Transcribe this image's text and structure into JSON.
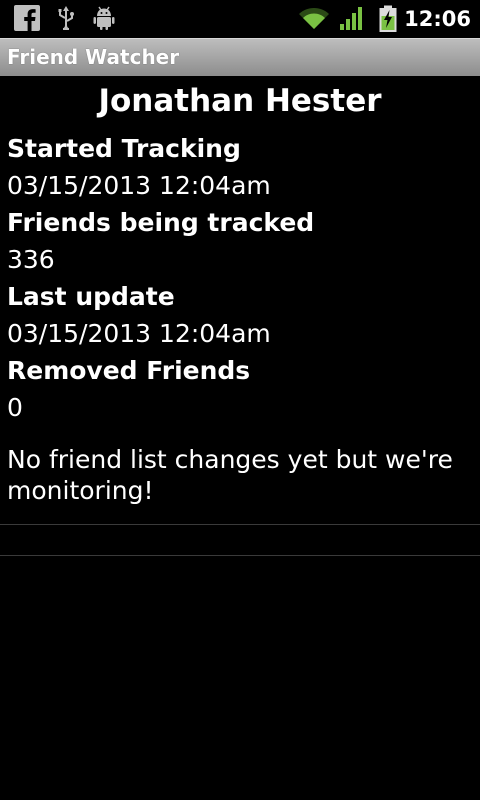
{
  "status_bar": {
    "icons": [
      "facebook-icon",
      "usb-icon",
      "android-debug-icon",
      "wifi-icon",
      "signal-icon",
      "battery-charging-icon"
    ],
    "time": "12:06"
  },
  "app": {
    "title": "Friend Watcher"
  },
  "profile": {
    "name": "Jonathan Hester",
    "started_tracking_label": "Started Tracking",
    "started_tracking_value": "03/15/2013 12:04am",
    "friends_tracked_label": "Friends being tracked",
    "friends_tracked_value": "336",
    "last_update_label": "Last update",
    "last_update_value": "03/15/2013 12:04am",
    "removed_friends_label": "Removed Friends",
    "removed_friends_value": "0",
    "message": "No friend list changes yet but we're monitoring!"
  },
  "colors": {
    "background": "#000000",
    "text": "#ffffff",
    "title_bar": "#a5a5a5",
    "status_green": "#7ac143"
  }
}
